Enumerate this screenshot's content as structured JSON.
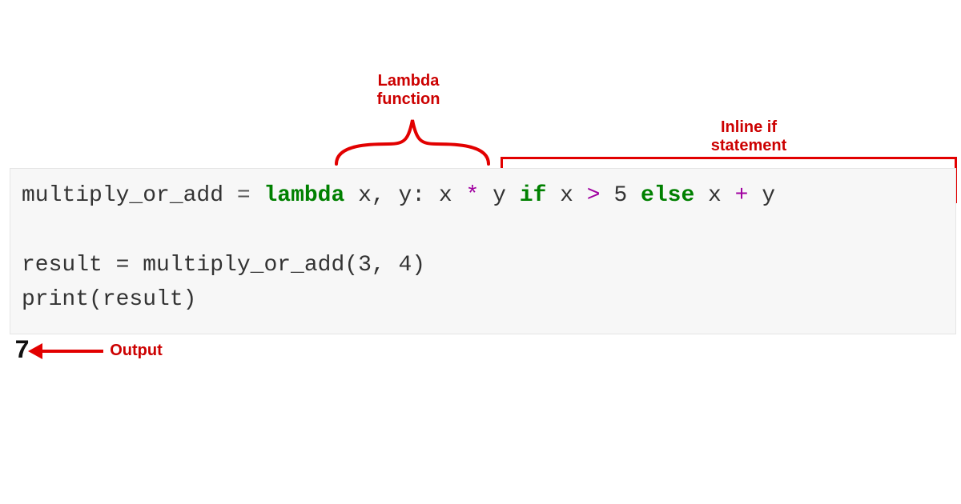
{
  "annotation_lambda_line1": "Lambda",
  "annotation_lambda_line2": "function",
  "annotation_inline_line1": "Inline if",
  "annotation_inline_line2": "statement",
  "annotation_output": "Output",
  "code": {
    "line1": {
      "var": "multiply_or_add",
      "assign": " = ",
      "lambda": "lambda",
      "params": " x, y: ",
      "expr_x1": "x ",
      "star": "*",
      "expr_y": " y ",
      "if": "if",
      "cond_x": " x ",
      "gt": ">",
      "cond_five": " 5 ",
      "else": "else",
      "expr_x2": " x ",
      "plus": "+",
      "expr_y2": " y"
    },
    "line2_blank": "",
    "line3": "result = multiply_or_add(3, 4)",
    "line4": "print(result)"
  },
  "output_value": "7",
  "colors": {
    "keyword": "#008000",
    "operator": "#a000a0",
    "annotation": "#cc0000",
    "box": "#e20000",
    "code_bg": "#f7f7f7"
  }
}
